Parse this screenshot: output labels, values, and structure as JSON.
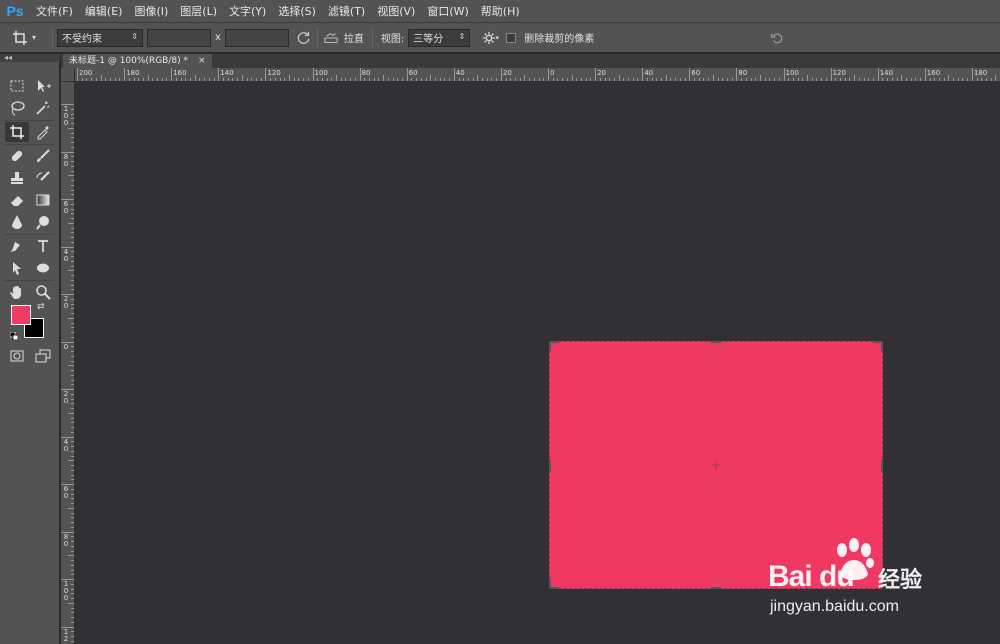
{
  "app": {
    "logo": "Ps"
  },
  "menu": [
    "文件(F)",
    "编辑(E)",
    "图像(I)",
    "图层(L)",
    "文字(Y)",
    "选择(S)",
    "滤镜(T)",
    "视图(V)",
    "窗口(W)",
    "帮助(H)"
  ],
  "options": {
    "ratio_select": "不受约束",
    "x_label": "x",
    "straighten_label": "拉直",
    "view_label": "视图:",
    "view_select": "三等分",
    "delete_cropped_label": "删除裁剪的像素",
    "delete_cropped_checked": false
  },
  "toolbox": {
    "collapse": "◂◂",
    "foreground_color": "#f03c65",
    "background_color": "#000000"
  },
  "document": {
    "tab_title": "未标题-1 @ 100%(RGB/8) *",
    "close": "×"
  },
  "ruler_top": {
    "labels": [
      "200",
      "180",
      "160",
      "140",
      "120",
      "100",
      "80",
      "60",
      "40",
      "20",
      "0",
      "20",
      "40",
      "60",
      "80",
      "100",
      "120",
      "140",
      "160",
      "180"
    ]
  },
  "ruler_left": {
    "labels": [
      "100",
      "80",
      "60",
      "40",
      "20",
      "0",
      "20",
      "40",
      "60",
      "80",
      "100",
      "12"
    ]
  },
  "canvas": {
    "fill_color": "#ef3963",
    "workspace_color": "#323034"
  },
  "watermark": {
    "brand": "Bai du",
    "brand_cn": "经验",
    "url": "jingyan.baidu.com"
  },
  "icons": [
    "crop-icon",
    "rotate-icon",
    "straighten-icon",
    "gear-icon",
    "reset-icon",
    "marquee-icon",
    "move-icon",
    "lasso-icon",
    "magic-wand-icon",
    "eyedropper-icon",
    "healing-icon",
    "brush-icon",
    "stamp-icon",
    "history-brush-icon",
    "eraser-icon",
    "gradient-icon",
    "blur-icon",
    "dodge-icon",
    "pen-icon",
    "type-icon",
    "path-select-icon",
    "ellipse-icon",
    "hand-icon",
    "zoom-icon",
    "quick-mask-icon",
    "screen-mode-icon"
  ]
}
